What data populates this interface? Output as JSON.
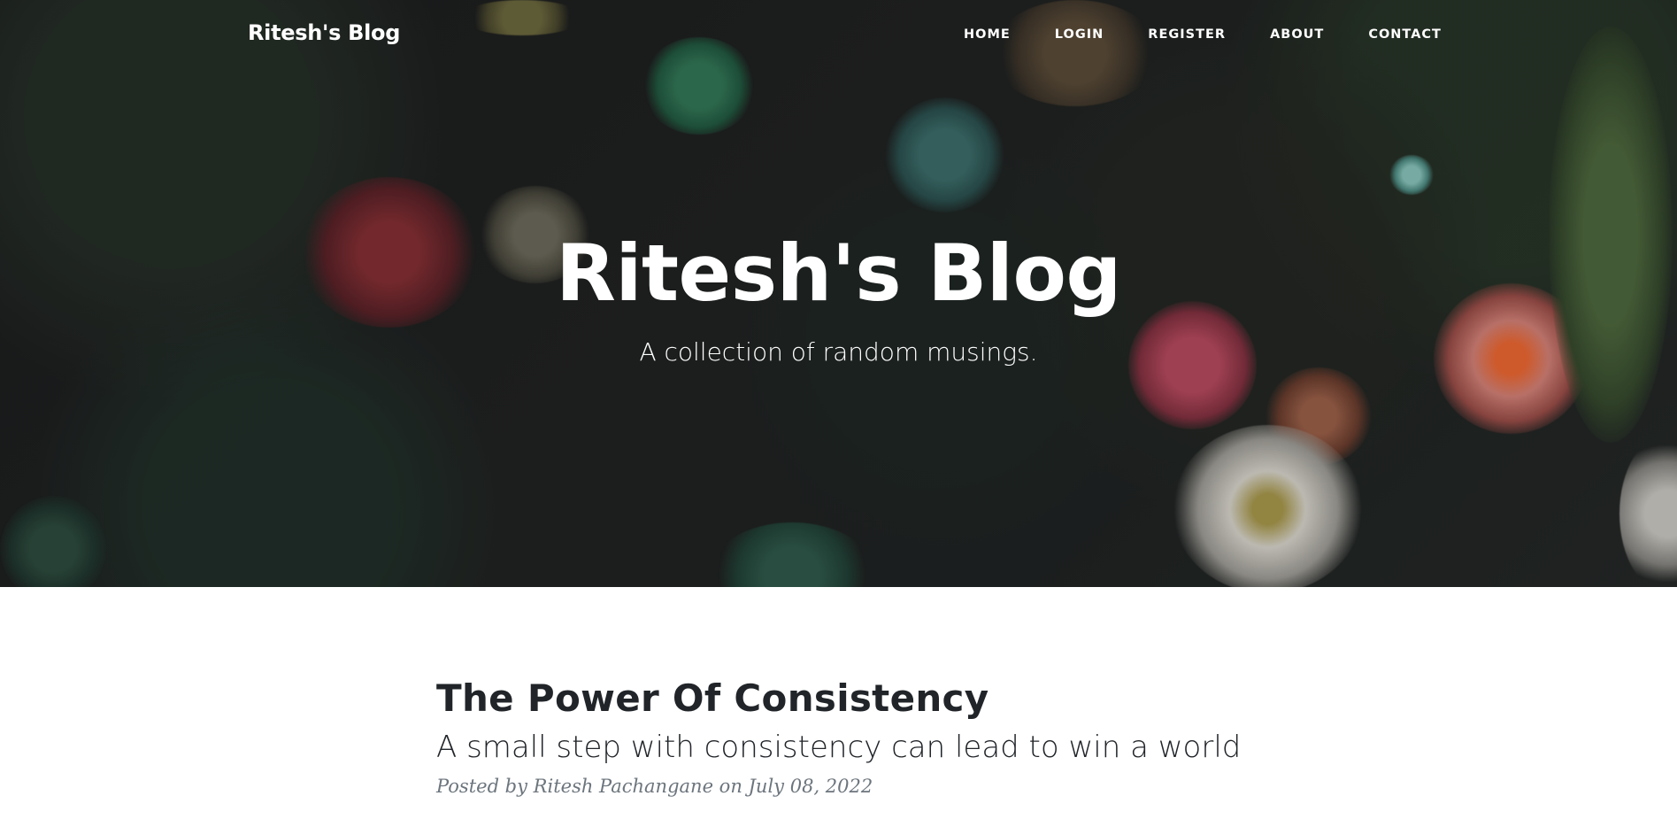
{
  "navbar": {
    "brand": "Ritesh's Blog",
    "links": [
      {
        "label": "HOME"
      },
      {
        "label": "LOGIN"
      },
      {
        "label": "REGISTER"
      },
      {
        "label": "ABOUT"
      },
      {
        "label": "CONTACT"
      }
    ]
  },
  "hero": {
    "title": "Ritesh's Blog",
    "subtitle": "A collection of random musings."
  },
  "post": {
    "title": "The Power Of Consistency",
    "subtitle": "A small step with consistency can lead to win a world",
    "meta_prefix": "Posted by ",
    "author": "Ritesh Pachangane",
    "meta_date": " on July 08, 2022"
  },
  "colors": {
    "text_dark": "#212529",
    "meta_gray": "#6c757d",
    "hero_bg": "#151515"
  }
}
